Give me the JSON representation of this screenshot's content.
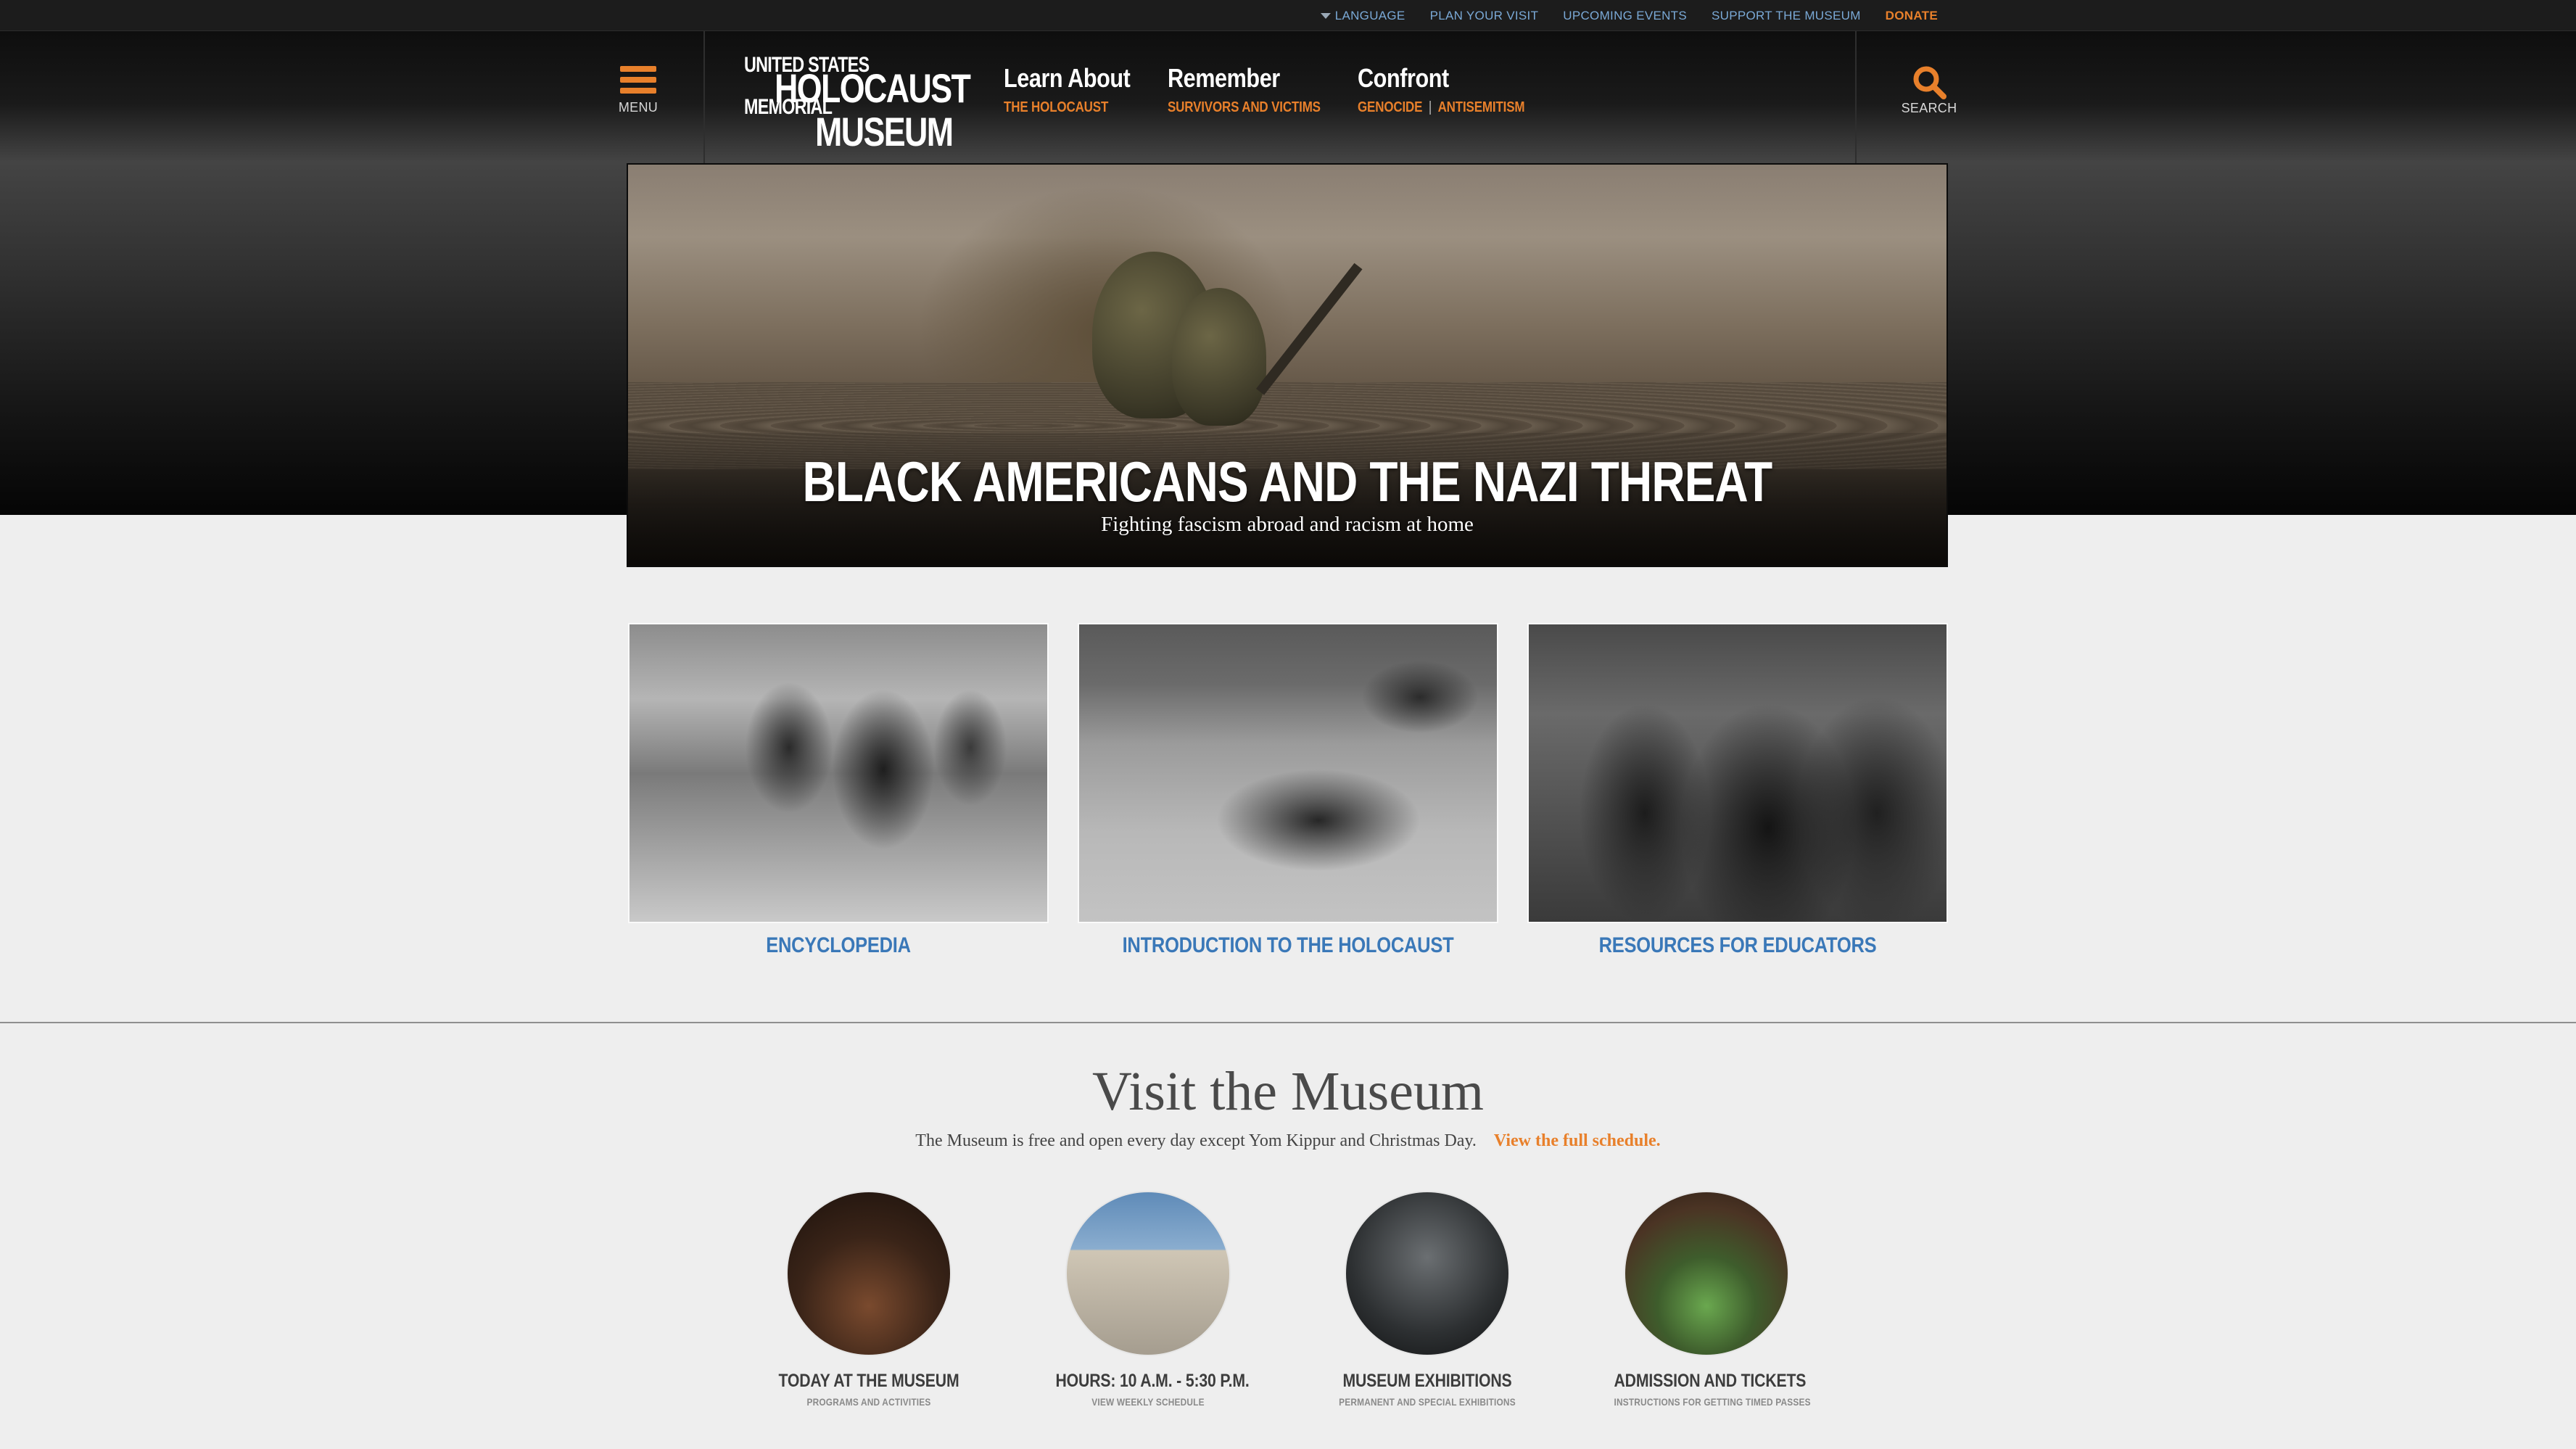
{
  "utility_links": [
    {
      "label": "LANGUAGE"
    },
    {
      "label": "PLAN YOUR VISIT"
    },
    {
      "label": "UPCOMING EVENTS"
    },
    {
      "label": "SUPPORT THE MUSEUM"
    },
    {
      "label": "DONATE"
    }
  ],
  "header": {
    "menu_label": "MENU",
    "search_label": "SEARCH",
    "logo": {
      "line1": "UNITED STATES",
      "line2": "HOLOCAUST",
      "line3": "MEMORIAL",
      "line4": "MUSEUM"
    },
    "nav": [
      {
        "title": "Learn About",
        "sub": [
          "THE HOLOCAUST"
        ]
      },
      {
        "title": "Remember",
        "sub": [
          "SURVIVORS AND VICTIMS"
        ]
      },
      {
        "title": "Confront",
        "sub": [
          "GENOCIDE",
          "ANTISEMITISM"
        ],
        "separator": "|"
      }
    ]
  },
  "hero": {
    "title": "BLACK AMERICANS AND THE NAZI THREAT",
    "subtitle": "Fighting fascism abroad and racism at home"
  },
  "cards": [
    {
      "label": "ENCYCLOPEDIA"
    },
    {
      "label": "INTRODUCTION TO THE HOLOCAUST"
    },
    {
      "label": "RESOURCES FOR EDUCATORS"
    }
  ],
  "visit": {
    "title": "Visit the Museum",
    "intro": "The Museum is free and open every day except Yom Kippur and Christmas Day.",
    "schedule_link": "View the full schedule.",
    "items": [
      {
        "label": "TODAY AT THE MUSEUM",
        "sublabel": "PROGRAMS AND ACTIVITIES"
      },
      {
        "label": "HOURS: 10 A.M. - 5:30 P.M.",
        "sublabel": "VIEW WEEKLY SCHEDULE"
      },
      {
        "label": "MUSEUM EXHIBITIONS",
        "sublabel": "PERMANENT AND SPECIAL EXHIBITIONS"
      },
      {
        "label": "ADMISSION AND TICKETS",
        "sublabel": "INSTRUCTIONS FOR GETTING TIMED PASSES"
      }
    ]
  },
  "colors": {
    "accent_orange": "#e8802b",
    "link_blue": "#3a78b8",
    "utility_link_blue": "#7aa9d6",
    "header_dark": "#0e0e0e",
    "page_bg": "#eeeeee"
  },
  "icons": {
    "menu": "hamburger-icon",
    "search": "search-icon",
    "language": "caret-down-icon"
  }
}
